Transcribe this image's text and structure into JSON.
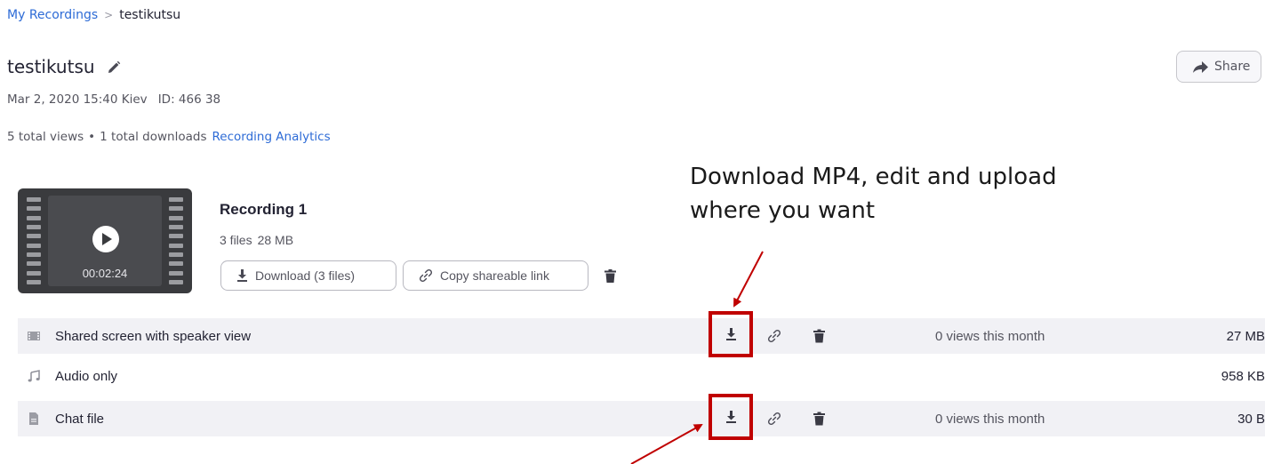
{
  "breadcrumb": {
    "root": "My Recordings",
    "separator": ">",
    "current": "testikutsu"
  },
  "meeting": {
    "title": "testikutsu",
    "date": "Mar 2, 2020 15:40 Kiev",
    "id": "ID: 466 38",
    "views": "5 total views",
    "bullet": "•",
    "downloads": "1 total downloads",
    "analytics_link": "Recording Analytics"
  },
  "share_label": "Share",
  "recording": {
    "duration": "00:02:24",
    "title": "Recording 1",
    "file_count": "3 files",
    "size": "28 MB",
    "download_label": "Download (3 files)",
    "copy_label": "Copy shareable link"
  },
  "annotation": {
    "line1": "Download MP4, edit and upload",
    "line2": "where you want",
    "color": "#c00000"
  },
  "files": [
    {
      "name": "Shared screen with speaker view",
      "icon": "film-icon",
      "views": "0 views this month",
      "size": "27 MB"
    },
    {
      "name": "Audio only",
      "icon": "music-note-icon",
      "views": "",
      "size": "958 KB"
    },
    {
      "name": "Chat file",
      "icon": "document-icon",
      "views": "0 views this month",
      "size": "30 B"
    }
  ]
}
